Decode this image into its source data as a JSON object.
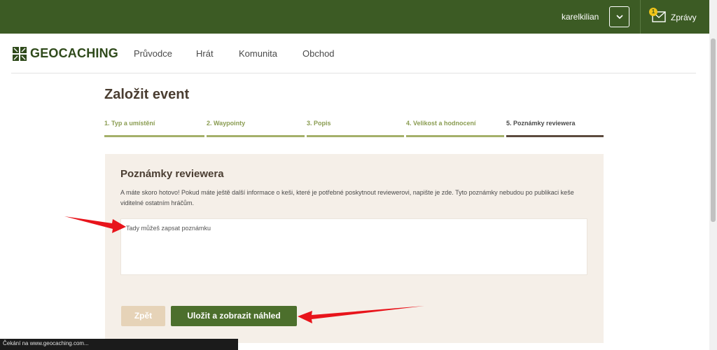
{
  "header": {
    "username": "karelkilian",
    "mail_badge": "1",
    "messages_label": "Zprávy"
  },
  "nav": {
    "logo_text": "GEOCACHING",
    "items": [
      "Průvodce",
      "Hrát",
      "Komunita",
      "Obchod"
    ]
  },
  "page": {
    "title": "Založit event"
  },
  "steps": [
    {
      "label": "1. Typ a umístění",
      "active": false
    },
    {
      "label": "2. Waypointy",
      "active": false
    },
    {
      "label": "3. Popis",
      "active": false
    },
    {
      "label": "4. Velikost a hodnocení",
      "active": false
    },
    {
      "label": "5. Poznámky reviewera",
      "active": true
    }
  ],
  "panel": {
    "title": "Poznámky reviewera",
    "description": "A máte skoro hotovo! Pokud máte ještě další informace o keši, které je potřebné poskytnout reviewerovi, napište je zde. Tyto poznámky nebudou po publikaci keše viditelné ostatním hráčům.",
    "notes_value": "Tady můžeš zapsat poznámku"
  },
  "buttons": {
    "back_label": "Zpět",
    "save_label": "Uložit a zobrazit náhled"
  },
  "statusbar": {
    "text": "Čekání na www.geocaching.com..."
  },
  "colors": {
    "topbar": "#3c5b24",
    "accent_green": "#4c6f2c",
    "panel_bg": "#f5efe8",
    "annotation_arrow": "#e8141b"
  },
  "icons": [
    "chevron-down-icon",
    "mail-icon",
    "geocaching-logo-icon"
  ]
}
